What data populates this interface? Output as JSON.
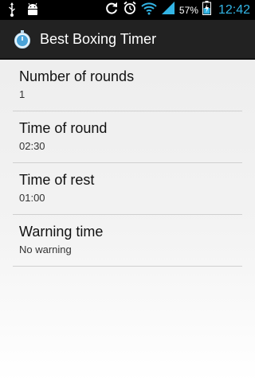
{
  "status_bar": {
    "left_icons": [
      "usb-icon",
      "android-debug-icon"
    ],
    "right_icons": [
      "sync-icon",
      "alarm-icon",
      "wifi-icon",
      "signal-icon",
      "battery-icon"
    ],
    "battery_percent": "57%",
    "time": "12:42",
    "time_color": "#33b5e5"
  },
  "action_bar": {
    "app_icon": "stopwatch-icon",
    "title": "Best Boxing Timer"
  },
  "settings": [
    {
      "title": "Number of rounds",
      "value": "1"
    },
    {
      "title": "Time of round",
      "value": "02:30"
    },
    {
      "title": "Time of rest",
      "value": "01:00"
    },
    {
      "title": "Warning time",
      "value": "No warning"
    }
  ]
}
